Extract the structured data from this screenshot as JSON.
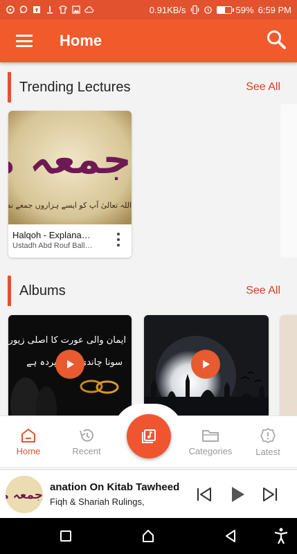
{
  "status_bar": {
    "speed": "0.91KB/s",
    "battery_pct": "59%",
    "battery_level": 0.59,
    "time": "6:59 PM",
    "left_icons": [
      "whatsapp-icon",
      "chat-icon",
      "upload-icon",
      "notification-icon",
      "shirt-icon",
      "image-icon",
      "cloud-icon"
    ],
    "right_icons": [
      "vibrate-icon",
      "alarm-icon",
      "battery-icon"
    ]
  },
  "app_bar": {
    "title": "Home",
    "menu_icon": "hamburger-icon",
    "search_icon": "search-icon",
    "color": "#f15a2b"
  },
  "sections": {
    "trending": {
      "title": "Trending Lectures",
      "see_all": "See All",
      "cards": [
        {
          "title": "Halqoh - Explana…",
          "subtitle": "Ustadh Abd Rouf Ball…",
          "thumb_text": "جمعہ مبارک",
          "thumb_caption": "اللہ تعالیٰ آپ کو ایسے ہزاروں جمعے نصیب فرمائے"
        }
      ]
    },
    "albums": {
      "title": "Albums",
      "see_all": "See All",
      "cards": [
        {
          "thumb_text": "ایمان والی عورت کا اصلی زیور",
          "thumb_text2": "سونا چاندی نہیں پردہ ہے"
        },
        {
          "thumb_text": ""
        }
      ]
    }
  },
  "bottom_nav": {
    "items": [
      {
        "label": "Home",
        "icon": "home-icon",
        "active": true
      },
      {
        "label": "Recent",
        "icon": "history-icon",
        "active": false
      },
      {
        "label": "Categories",
        "icon": "folder-icon",
        "active": false
      },
      {
        "label": "Latest",
        "icon": "alert-badge-icon",
        "active": false
      }
    ],
    "fab_icon": "playlist-icon"
  },
  "mini_player": {
    "title": "anation On Kitab Tawheed",
    "subtitle": "Fiqh & Shariah Rulings,",
    "art_text": "جمعہ مبارک"
  },
  "system_nav": {
    "items": [
      "recents-square-icon",
      "home-circle-icon",
      "back-triangle-icon",
      "accessibility-icon"
    ]
  },
  "colors": {
    "accent": "#e2522f",
    "see_all": "#d5411f",
    "background": "#f3f3f3"
  }
}
